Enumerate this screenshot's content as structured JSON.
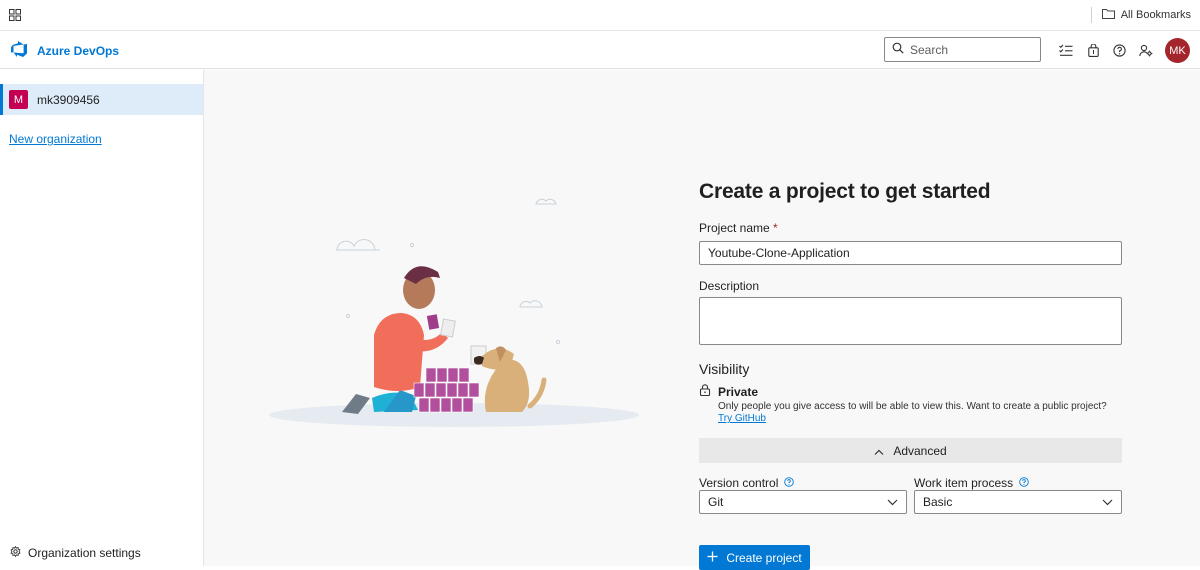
{
  "browser": {
    "apps_icon": "apps-grid-icon",
    "bookmarks_label": "All Bookmarks",
    "bookmarks_icon": "folder-icon"
  },
  "header": {
    "logo_icon": "azure-devops-logo-icon",
    "app_name": "Azure DevOps",
    "search_placeholder": "Search",
    "icons": [
      "work-items-list-icon",
      "marketplace-bag-icon",
      "help-icon",
      "user-settings-icon"
    ],
    "avatar_initials": "MK",
    "accent_color": "#0078d4",
    "avatar_color": "#a4262c"
  },
  "sidebar": {
    "organization": {
      "badge": "M",
      "name": "mk3909456",
      "badge_color": "#c30052"
    },
    "new_org_label": "New organization",
    "settings_label": "Organization settings",
    "settings_icon": "gear-icon"
  },
  "form": {
    "title": "Create a project to get started",
    "project_name_label": "Project name",
    "required_mark": "*",
    "project_name_value": "Youtube-Clone-Application",
    "description_label": "Description",
    "description_value": "",
    "visibility_label": "Visibility",
    "visibility_option": "Private",
    "visibility_desc": "Only people you give access to will be able to view this. Want to create a public project?",
    "try_github_label": "Try GitHub",
    "advanced_label": "Advanced",
    "version_control_label": "Version control",
    "version_control_value": "Git",
    "work_item_label": "Work item process",
    "work_item_value": "Basic",
    "create_button_label": "Create project"
  }
}
